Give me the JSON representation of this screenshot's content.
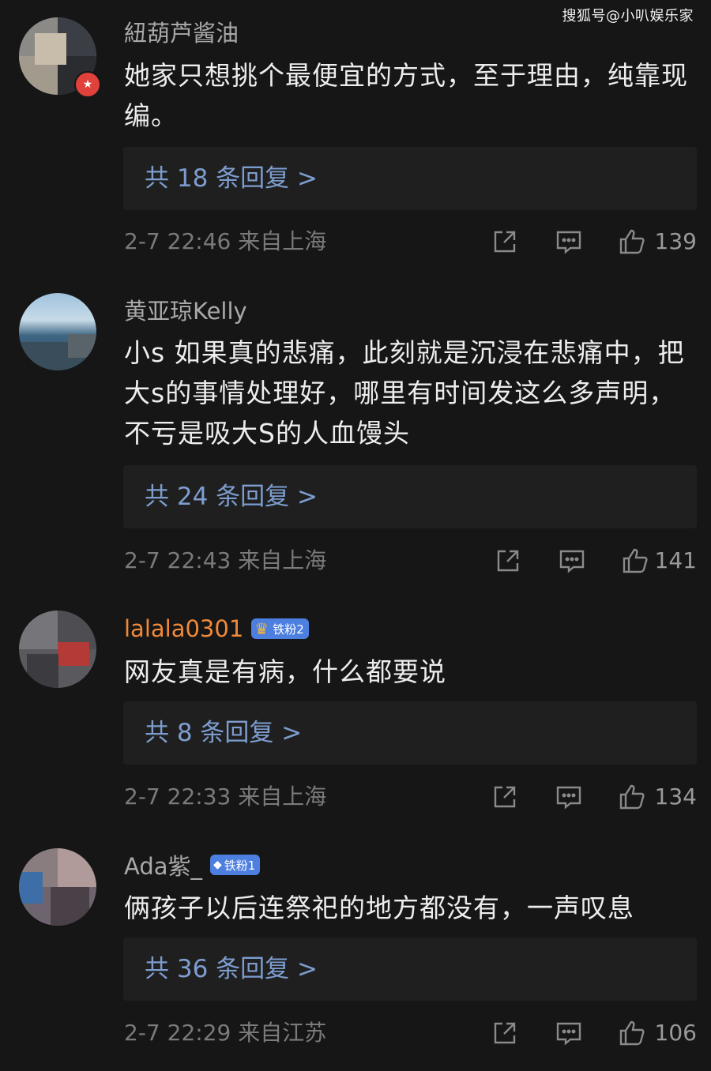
{
  "watermark": "搜狐号@小叭娱乐家",
  "comments": [
    {
      "username": "紐葫芦酱油",
      "text": "她家只想挑个最便宜的方式，至于理由，纯靠现编。",
      "replies": "共 18 条回复 >",
      "time": "2-7 22:46  来自上海",
      "likes": "139",
      "vip_icon": "star-icon"
    },
    {
      "username": "黄亚琼Kelly",
      "text": "小s 如果真的悲痛，此刻就是沉浸在悲痛中，把大s的事情处理好，哪里有时间发这么多声明，不亏是吸大S的人血馒头",
      "replies": "共 24 条回复 >",
      "time": "2-7 22:43  来自上海",
      "likes": "141"
    },
    {
      "username": "lalala0301",
      "badge": "铁粉2",
      "text": "网友真是有病，什么都要说",
      "replies": "共 8 条回复 >",
      "time": "2-7 22:33  来自上海",
      "likes": "134"
    },
    {
      "username": "Ada紫_",
      "badge": "铁粉1",
      "text": "俩孩子以后连祭祀的地方都没有，一声叹息",
      "replies": "共 36 条回复 >",
      "time": "2-7 22:29  来自江苏",
      "likes": "106"
    }
  ],
  "icons": [
    "share-icon",
    "comment-icon",
    "like-icon"
  ],
  "colors": {
    "background": "#161616",
    "reply_link": "#7d9dcf",
    "vip_username": "#f08a3a",
    "badge": "#4d7fe0"
  }
}
